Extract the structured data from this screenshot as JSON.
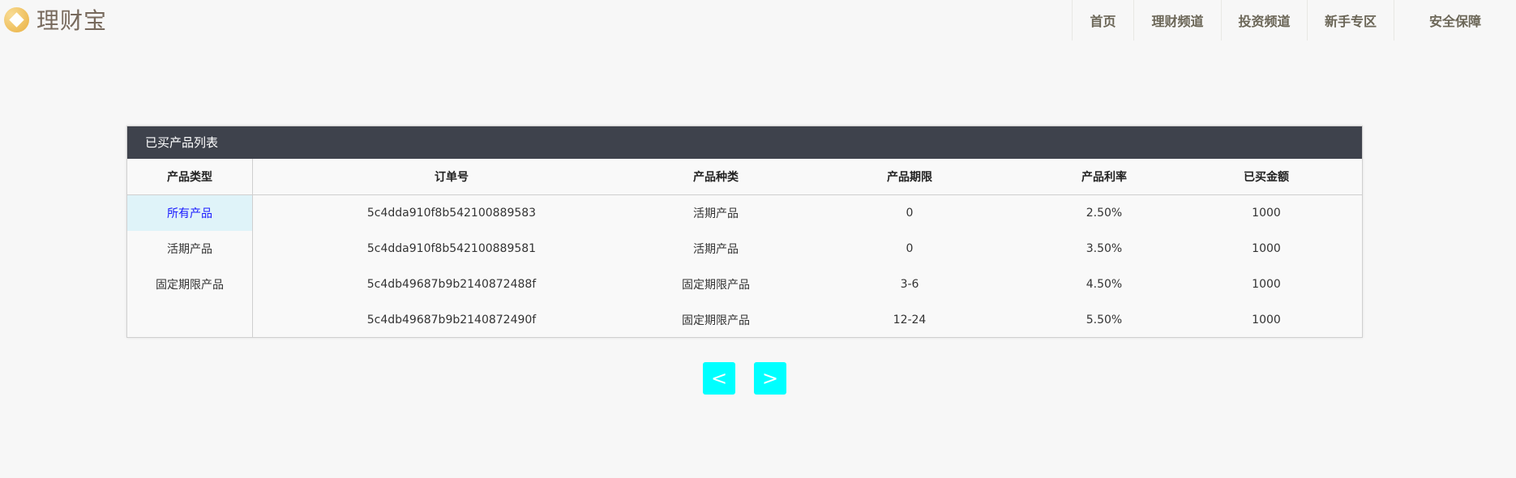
{
  "brand": {
    "name": "理财宝"
  },
  "nav": [
    "首页",
    "理财频道",
    "投资频道",
    "新手专区",
    "安全保障"
  ],
  "panel": {
    "title": "已买产品列表"
  },
  "sidebar": {
    "header": "产品类型",
    "items": [
      "所有产品",
      "活期产品",
      "固定期限产品"
    ],
    "active": "所有产品"
  },
  "table": {
    "headers": [
      "订单号",
      "产品种类",
      "产品期限",
      "产品利率",
      "已买金额"
    ],
    "rows": [
      [
        "5c4dda910f8b542100889583",
        "活期产品",
        "0",
        "2.50%",
        "1000"
      ],
      [
        "5c4dda910f8b542100889581",
        "活期产品",
        "0",
        "3.50%",
        "1000"
      ],
      [
        "5c4db49687b9b2140872488f",
        "固定期限产品",
        "3-6",
        "4.50%",
        "1000"
      ],
      [
        "5c4db49687b9b2140872490f",
        "固定期限产品",
        "12-24",
        "5.50%",
        "1000"
      ]
    ]
  },
  "pager": {
    "prev": "<",
    "next": ">",
    "color": "#00ffff"
  }
}
